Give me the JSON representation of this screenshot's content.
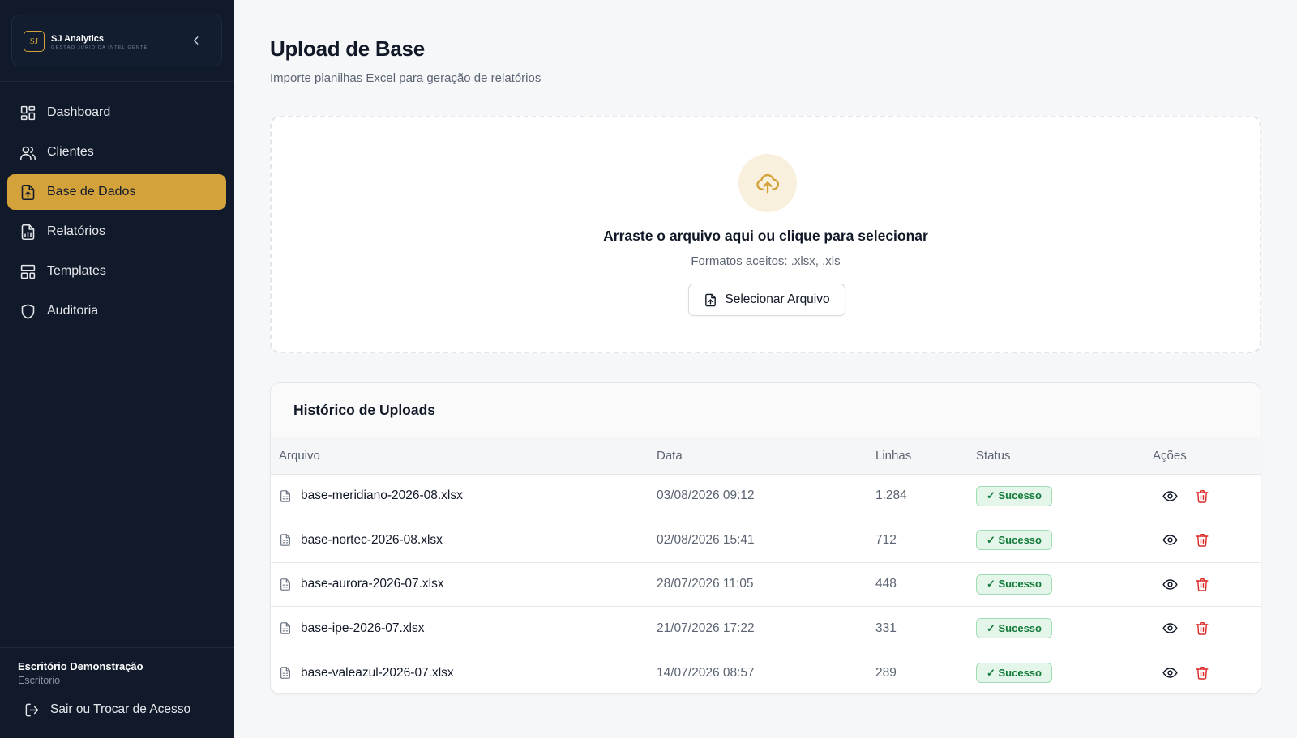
{
  "brand": {
    "logo_text": "SJ",
    "name": "SJ Analytics",
    "tagline": "GESTÃO JURÍDICA INTELIGENTE"
  },
  "sidebar": {
    "items": [
      {
        "label": "Dashboard",
        "icon": "dashboard-icon",
        "active": false
      },
      {
        "label": "Clientes",
        "icon": "users-icon",
        "active": false
      },
      {
        "label": "Base de Dados",
        "icon": "file-upload-icon",
        "active": true
      },
      {
        "label": "Relatórios",
        "icon": "report-icon",
        "active": false
      },
      {
        "label": "Templates",
        "icon": "layout-icon",
        "active": false
      },
      {
        "label": "Auditoria",
        "icon": "shield-icon",
        "active": false
      }
    ],
    "footer": {
      "office_name": "Escritório Demonstração",
      "office_role": "Escritorio",
      "logout_label": "Sair ou Trocar de Acesso"
    }
  },
  "page": {
    "title": "Upload de Base",
    "subtitle": "Importe planilhas Excel para geração de relatórios"
  },
  "dropzone": {
    "title": "Arraste o arquivo aqui ou clique para selecionar",
    "formats": "Formatos aceitos: .xlsx, .xls",
    "button_label": "Selecionar Arquivo"
  },
  "history": {
    "title": "Histórico de Uploads",
    "columns": [
      "Arquivo",
      "Data",
      "Linhas",
      "Status",
      "Ações"
    ],
    "rows": [
      {
        "file": "base-meridiano-2026-08.xlsx",
        "date": "03/08/2026 09:12",
        "lines": "1.284",
        "status": "✓ Sucesso"
      },
      {
        "file": "base-nortec-2026-08.xlsx",
        "date": "02/08/2026 15:41",
        "lines": "712",
        "status": "✓ Sucesso"
      },
      {
        "file": "base-aurora-2026-07.xlsx",
        "date": "28/07/2026 11:05",
        "lines": "448",
        "status": "✓ Sucesso"
      },
      {
        "file": "base-ipe-2026-07.xlsx",
        "date": "21/07/2026 17:22",
        "lines": "331",
        "status": "✓ Sucesso"
      },
      {
        "file": "base-valeazul-2026-07.xlsx",
        "date": "14/07/2026 08:57",
        "lines": "289",
        "status": "✓ Sucesso"
      }
    ]
  },
  "colors": {
    "sidebar_bg": "#111a2b",
    "accent": "#d4a23a",
    "success_text": "#137a3a",
    "success_bg": "#e4f6ea",
    "danger": "#dc2626"
  }
}
